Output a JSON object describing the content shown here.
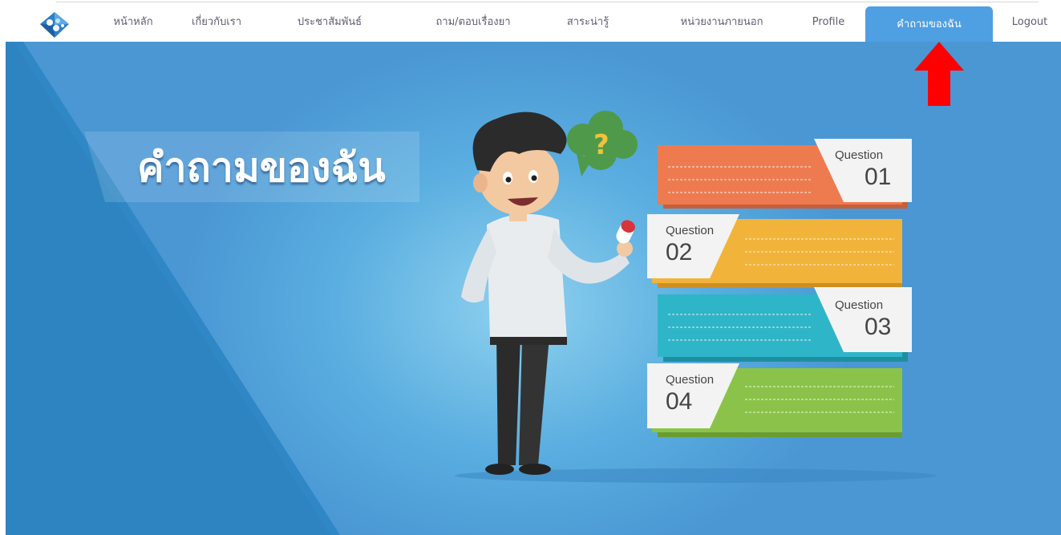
{
  "nav": {
    "items": [
      {
        "label": "หน้าหลัก",
        "active": false
      },
      {
        "label": "เกี่ยวกับเรา",
        "active": false
      },
      {
        "label": "ประชาสัมพันธ์",
        "active": false
      },
      {
        "label": "ถาม/ตอบเรื่องยา",
        "active": false
      },
      {
        "label": "สาระน่ารู้",
        "active": false
      },
      {
        "label": "หน่วยงานภายนอก",
        "active": false
      },
      {
        "label": "Profile",
        "active": false
      },
      {
        "label": "คำถามของฉัน",
        "active": true
      },
      {
        "label": "Logout",
        "active": false
      }
    ]
  },
  "banner": {
    "title": "คำถามของฉัน",
    "questions": [
      {
        "label": "Question",
        "number": "01",
        "color": "#ee7b4f"
      },
      {
        "label": "Question",
        "number": "02",
        "color": "#f2b33b"
      },
      {
        "label": "Question",
        "number": "03",
        "color": "#2fb5c8"
      },
      {
        "label": "Question",
        "number": "04",
        "color": "#8bc34a"
      }
    ],
    "bubble_icon": "question-bubble-icon"
  },
  "colors": {
    "accent": "#4f9fe3",
    "annotation_arrow": "#ff0000"
  }
}
